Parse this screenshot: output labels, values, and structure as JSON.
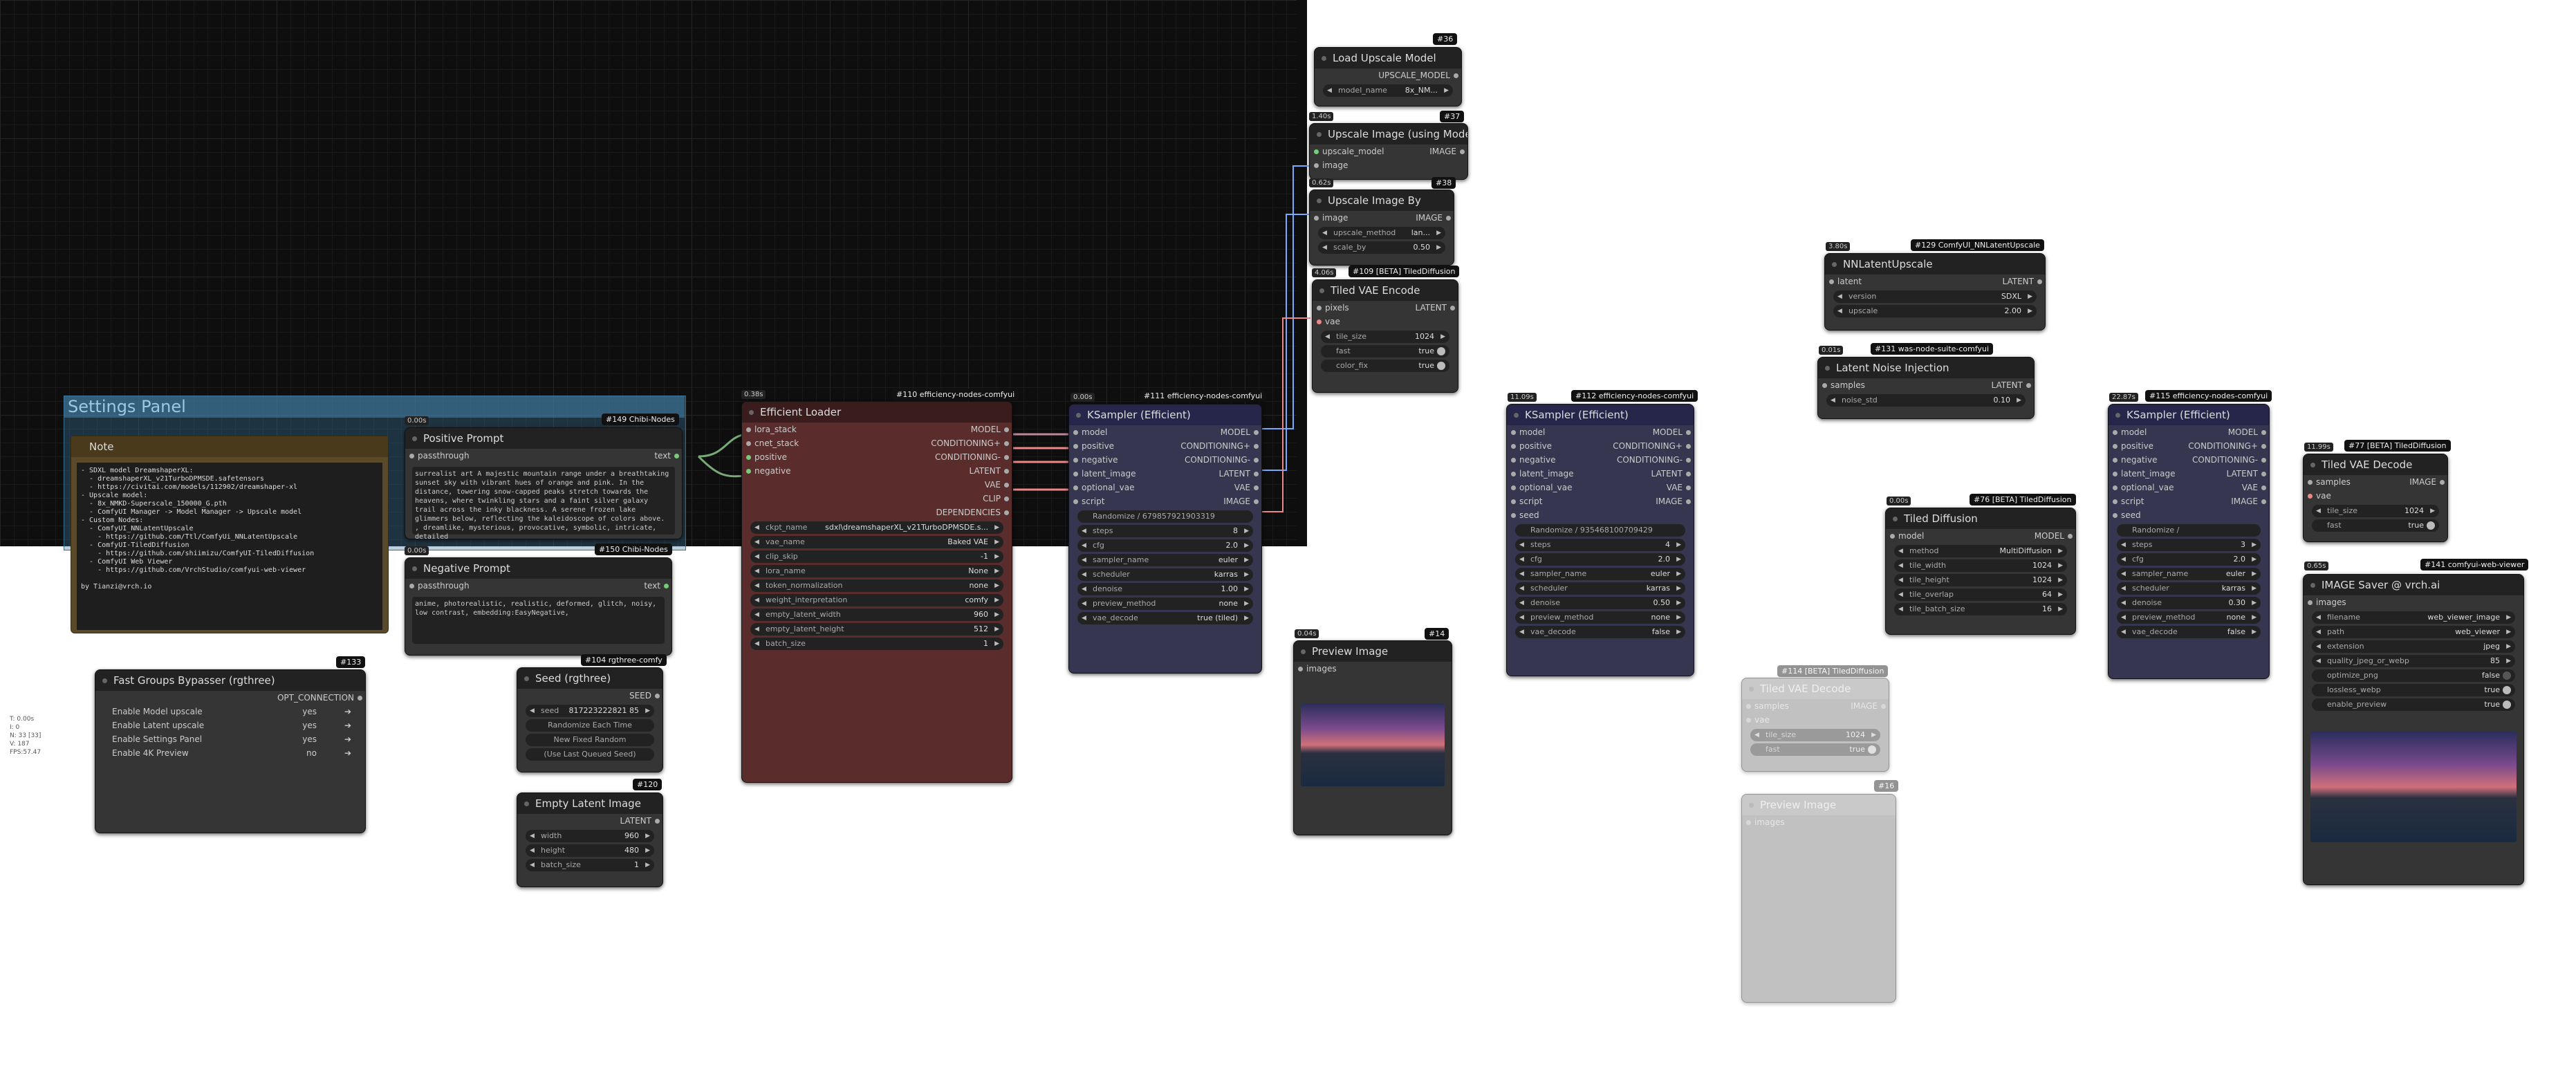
{
  "group": {
    "title": "Settings Panel"
  },
  "stats": "T: 0.00s\nI: 0\nN: 33 [33]\nV: 187\nFPS:57.47",
  "note": {
    "title": "Note",
    "text": "- SDXL model DreamshaperXL:\n  - dreamshaperXL_v21TurboDPMSDE.safetensors\n  - https://civitai.com/models/112902/dreamshaper-xl\n- Upscale model:\n  - 8x_NMKD-Superscale_150000_G.pth\n  - ComfyUI Manager -> Model Manager -> Upscale model\n- Custom Nodes:\n  - ComfyUI_NNLatentUpscale\n    - https://github.com/Ttl/ComfyUi_NNLatentUpscale\n  - ComfyUI-TiledDiffusion\n    - https://github.com/shiimizu/ComfyUI-TiledDiffusion\n  - ComfyUI Web Viewer\n    - https://github.com/VrchStudio/comfyui-web-viewer\n\nby Tianzi@vrch.io"
  },
  "positive": {
    "badge": "#149 Chibi-Nodes",
    "timer": "0.00s",
    "title": "Positive Prompt",
    "in": "passthrough",
    "out": "text",
    "text": "surrealist art A majestic mountain range under a breathtaking sunset sky with vibrant hues of orange and pink. In the distance, towering snow-capped peaks stretch towards the heavens, where twinkling stars and a faint silver galaxy trail across the inky blackness. A serene frozen lake glimmers below, reflecting the kaleidoscope of colors above. , dreamlike, mysterious, provocative, symbolic, intricate, detailed"
  },
  "negative": {
    "badge": "#150 Chibi-Nodes",
    "timer": "0.00s",
    "title": "Negative Prompt",
    "in": "passthrough",
    "out": "text",
    "text": "anime, photorealistic, realistic, deformed, glitch, noisy, low contrast, embedding:EasyNegative,"
  },
  "bypasser": {
    "badge": "#133",
    "title": "Fast Groups Bypasser (rgthree)",
    "out": "OPT_CONNECTION",
    "rows": [
      {
        "label": "Enable Model upscale",
        "val": "yes"
      },
      {
        "label": "Enable Latent upscale",
        "val": "yes"
      },
      {
        "label": "Enable Settings Panel",
        "val": "yes"
      },
      {
        "label": "Enable 4K Preview",
        "val": "no"
      }
    ]
  },
  "seed": {
    "badge": "#104 rgthree-comfy",
    "title": "Seed (rgthree)",
    "out": "SEED",
    "seed_label": "seed",
    "seed_val": "817223222821 85",
    "btn1": "Randomize Each Time",
    "btn2": "New Fixed Random",
    "btn3": "(Use Last Queued Seed)"
  },
  "latent": {
    "badge": "#120",
    "title": "Empty Latent Image",
    "out": "LATENT",
    "widgets": [
      {
        "l": "width",
        "v": "960"
      },
      {
        "l": "height",
        "v": "480"
      },
      {
        "l": "batch_size",
        "v": "1"
      }
    ]
  },
  "loader": {
    "badge": "#110 efficiency-nodes-comfyui",
    "timer": "0.38s",
    "title": "Efficient Loader",
    "ins": [
      "lora_stack",
      "cnet_stack",
      "positive",
      "negative"
    ],
    "outs": [
      "MODEL",
      "CONDITIONING+",
      "CONDITIONING-",
      "LATENT",
      "VAE",
      "CLIP",
      "DEPENDENCIES"
    ],
    "widgets": [
      {
        "l": "ckpt_name",
        "v": "sdxl\\dreamshaperXL_v21TurboDPMSDE.s..."
      },
      {
        "l": "vae_name",
        "v": "Baked VAE"
      },
      {
        "l": "clip_skip",
        "v": "-1"
      },
      {
        "l": "lora_name",
        "v": "None"
      },
      {
        "l": "token_normalization",
        "v": "none"
      },
      {
        "l": "weight_interpretation",
        "v": "comfy"
      },
      {
        "l": "empty_latent_width",
        "v": "960"
      },
      {
        "l": "empty_latent_height",
        "v": "512"
      },
      {
        "l": "batch_size",
        "v": "1"
      }
    ]
  },
  "ks1": {
    "badge": "#111 efficiency-nodes-comfyui",
    "timer": "0.00s",
    "title": "KSampler (Efficient)",
    "ins": [
      "model",
      "positive",
      "negative",
      "latent_image",
      "optional_vae",
      "script"
    ],
    "outs": [
      "MODEL",
      "CONDITIONING+",
      "CONDITIONING-",
      "LATENT",
      "VAE",
      "IMAGE"
    ],
    "seedrow": "Randomize / 679857921903319",
    "widgets": [
      {
        "l": "steps",
        "v": "8"
      },
      {
        "l": "cfg",
        "v": "2.0"
      },
      {
        "l": "sampler_name",
        "v": "euler"
      },
      {
        "l": "scheduler",
        "v": "karras"
      },
      {
        "l": "denoise",
        "v": "1.00"
      },
      {
        "l": "preview_method",
        "v": "none"
      },
      {
        "l": "vae_decode",
        "v": "true (tiled)"
      }
    ]
  },
  "preview14": {
    "badge": "#14",
    "timer": "0.04s",
    "title": "Preview Image",
    "in": "images"
  },
  "ks2": {
    "badge": "#112 efficiency-nodes-comfyui",
    "timer": "11.09s",
    "title": "KSampler (Efficient)",
    "ins": [
      "model",
      "positive",
      "negative",
      "latent_image",
      "optional_vae",
      "script",
      "seed"
    ],
    "outs": [
      "MODEL",
      "CONDITIONING+",
      "CONDITIONING-",
      "LATENT",
      "VAE",
      "IMAGE"
    ],
    "seedrow": "Randomize / 935468100709429",
    "widgets": [
      {
        "l": "steps",
        "v": "4"
      },
      {
        "l": "cfg",
        "v": "2.0"
      },
      {
        "l": "sampler_name",
        "v": "euler"
      },
      {
        "l": "scheduler",
        "v": "karras"
      },
      {
        "l": "denoise",
        "v": "0.50"
      },
      {
        "l": "preview_method",
        "v": "none"
      },
      {
        "l": "vae_decode",
        "v": "false"
      }
    ]
  },
  "loadup": {
    "badge": "#36",
    "title": "Load Upscale Model",
    "out": "UPSCALE_MODEL",
    "w": {
      "l": "model_name",
      "v": "8x_NM..."
    }
  },
  "upimg": {
    "badge": "#37",
    "timer": "1.40s",
    "title": "Upscale Image (using Model)",
    "ins": [
      "upscale_model",
      "image"
    ],
    "out": "IMAGE"
  },
  "upby": {
    "badge": "#38",
    "timer": "0.62s",
    "title": "Upscale Image By",
    "in": "image",
    "out": "IMAGE",
    "widgets": [
      {
        "l": "upscale_method",
        "v": "lan..."
      },
      {
        "l": "scale_by",
        "v": "0.50"
      }
    ]
  },
  "tvae": {
    "badge": "#109 [BETA] TiledDiffusion",
    "timer": "4.06s",
    "title": "Tiled VAE Encode",
    "ins": [
      "pixels",
      "vae"
    ],
    "out": "LATENT",
    "widgets": [
      {
        "l": "tile_size",
        "v": "1024"
      },
      {
        "l": "fast",
        "v": "true"
      },
      {
        "l": "color_fix",
        "v": "true"
      }
    ]
  },
  "nnl": {
    "badge": "#129 ComfyUI_NNLatentUpscale",
    "timer": "3.80s",
    "title": "NNLatentUpscale",
    "in": "latent",
    "out": "LATENT",
    "widgets": [
      {
        "l": "version",
        "v": "SDXL"
      },
      {
        "l": "upscale",
        "v": "2.00"
      }
    ]
  },
  "lni": {
    "badge": "#131 was-node-suite-comfyui",
    "timer": "0.01s",
    "title": "Latent Noise Injection",
    "in": "samples",
    "out": "LATENT",
    "widgets": [
      {
        "l": "noise_std",
        "v": "0.10"
      }
    ]
  },
  "tdiff": {
    "badge": "#76 [BETA] TiledDiffusion",
    "timer": "0.00s",
    "title": "Tiled Diffusion",
    "in": "model",
    "out": "MODEL",
    "widgets": [
      {
        "l": "method",
        "v": "MultiDiffusion"
      },
      {
        "l": "tile_width",
        "v": "1024"
      },
      {
        "l": "tile_height",
        "v": "1024"
      },
      {
        "l": "tile_overlap",
        "v": "64"
      },
      {
        "l": "tile_batch_size",
        "v": "16"
      }
    ]
  },
  "ghostvae": {
    "badge": "#114 [BETA] TiledDiffusion",
    "title": "Tiled VAE Decode",
    "ins": [
      "samples",
      "vae"
    ],
    "out": "IMAGE",
    "widgets": [
      {
        "l": "tile_size",
        "v": "1024"
      },
      {
        "l": "fast",
        "v": "true"
      }
    ]
  },
  "ghostprev": {
    "badge": "#16",
    "title": "Preview Image",
    "in": "images"
  },
  "ks3": {
    "badge": "#115 efficiency-nodes-comfyui",
    "timer": "22.87s",
    "title": "KSampler (Efficient)",
    "ins": [
      "model",
      "positive",
      "negative",
      "latent_image",
      "optional_vae",
      "script",
      "seed"
    ],
    "outs": [
      "MODEL",
      "CONDITIONING+",
      "CONDITIONING-",
      "LATENT",
      "VAE",
      "IMAGE"
    ],
    "seedrow": "Randomize / 564363240121126",
    "widgets": [
      {
        "l": "steps",
        "v": "3"
      },
      {
        "l": "cfg",
        "v": "2.0"
      },
      {
        "l": "sampler_name",
        "v": "euler"
      },
      {
        "l": "scheduler",
        "v": "karras"
      },
      {
        "l": "denoise",
        "v": "0.30"
      },
      {
        "l": "preview_method",
        "v": "none"
      },
      {
        "l": "vae_decode",
        "v": "false"
      }
    ]
  },
  "tvd": {
    "badge": "#77 [BETA] TiledDiffusion",
    "timer": "11.99s",
    "title": "Tiled VAE Decode",
    "ins": [
      "samples",
      "vae"
    ],
    "out": "IMAGE",
    "widgets": [
      {
        "l": "tile_size",
        "v": "1024"
      },
      {
        "l": "fast",
        "v": "true"
      }
    ]
  },
  "saver": {
    "badge": "#141 comfyui-web-viewer",
    "timer": "0.65s",
    "title": "IMAGE Saver @ vrch.ai",
    "in": "images",
    "widgets": [
      {
        "l": "filename",
        "v": "web_viewer_image"
      },
      {
        "l": "path",
        "v": "web_viewer"
      },
      {
        "l": "extension",
        "v": "jpeg"
      },
      {
        "l": "quality_jpeg_or_webp",
        "v": "85"
      },
      {
        "l": "optimize_png",
        "v": "false"
      },
      {
        "l": "lossless_webp",
        "v": "true"
      },
      {
        "l": "enable_preview",
        "v": "true"
      }
    ]
  }
}
